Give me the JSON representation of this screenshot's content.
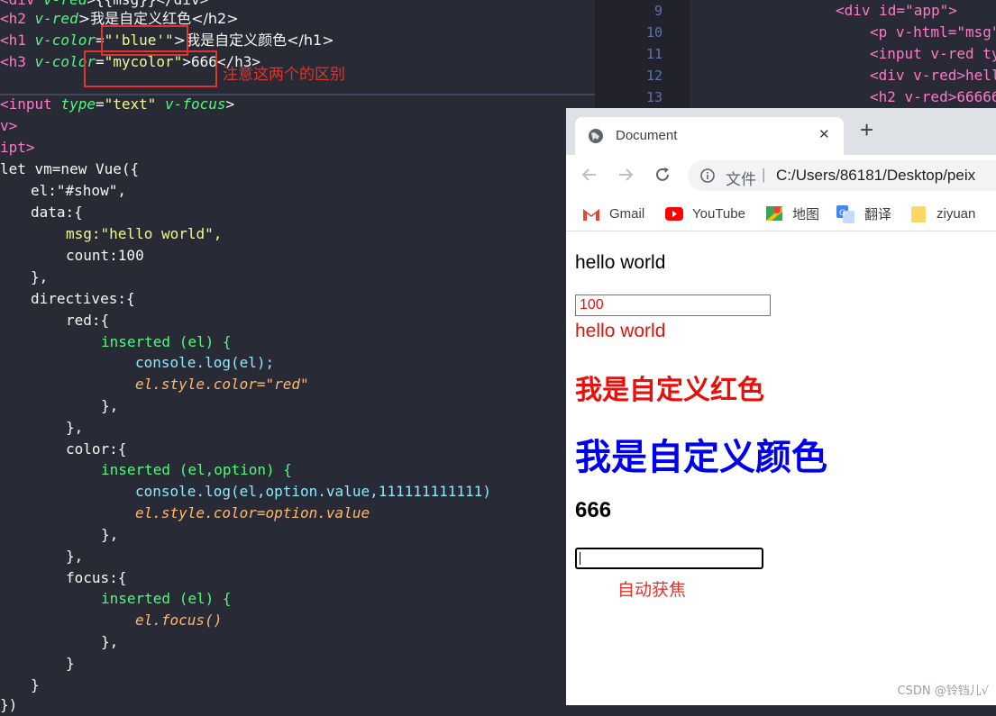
{
  "editor_left": {
    "top_lines": [
      {
        "p1": "<div ",
        "p2": "v-red",
        "p3": ">{{msg}}</div>"
      },
      {
        "tag_open": "<h2 ",
        "attr": "v-red",
        "rest": ">我是自定义红色</h2>"
      },
      {
        "tag_open": "<h1 ",
        "attr": "v-color",
        "eq": "=",
        "val": "\"'blue'\"",
        "rest": ">我是自定义颜色</h1>"
      },
      {
        "tag_open": "<h3 ",
        "attr": "v-color",
        "eq": "=",
        "val": "\"mycolor\"",
        "rest": ">666</h3>"
      }
    ],
    "annotation": "注意这两个的区别",
    "input_line": {
      "tag": "<input ",
      "attr": "type",
      "eq": "=",
      "val": "\"text\"",
      "dir": "v-focus",
      "close": ">"
    },
    "lines": [
      "v>",
      "ipt>",
      "let vm=new Vue({",
      "el:\"#show\",",
      "data:{",
      "msg:\"hello world\",",
      "count:100",
      "},",
      "directives:{",
      "red:{",
      "inserted (el) {",
      "console.log(el);",
      "el.style.color=\"red\"",
      "},",
      "},",
      "color:{",
      "inserted (el,option) {",
      "console.log(el,option.value,111111111111)",
      "el.style.color=option.value",
      "},",
      "},",
      "focus:{",
      "inserted (el) {",
      "el.focus()",
      "},",
      "}",
      "}",
      "})"
    ]
  },
  "editor_right": {
    "line_numbers": [
      "9",
      "10",
      "11",
      "12",
      "13"
    ],
    "lines": [
      "<div id=\"app\">",
      "<p v-html=\"msg\"",
      "<input v-red ty",
      "<div v-red>hell",
      "<h2 v-red>66666"
    ]
  },
  "browser": {
    "tab_title": "Document",
    "close_label": "✕",
    "new_tab_label": "+",
    "url_prefix": "文件",
    "url_separator": "|",
    "url": "C:/Users/86181/Desktop/peix",
    "bookmarks": [
      "Gmail",
      "YouTube",
      "地图",
      "翻译",
      "ziyuan"
    ],
    "content": {
      "p_text": "hello world",
      "input_value": "100",
      "div_text": "hello world",
      "h2_text": "我是自定义红色",
      "h1_text": "我是自定义颜色",
      "h3_text": "666",
      "focus_note": "自动获焦"
    },
    "colors": {
      "red": "#e8100c",
      "blue": "#0000ee"
    }
  },
  "watermark": "CSDN @铃铛儿√"
}
